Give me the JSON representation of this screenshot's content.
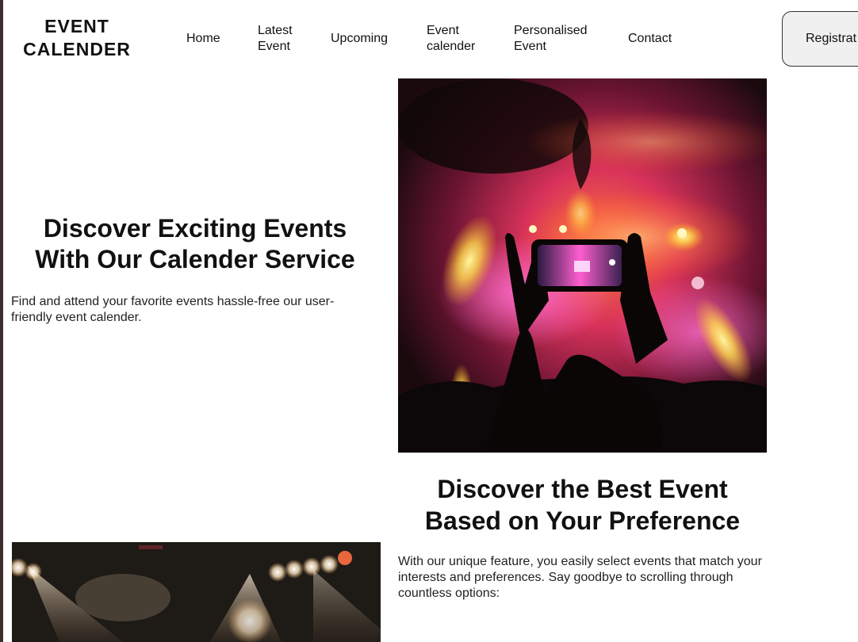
{
  "header": {
    "logo_line1": "EVENT",
    "logo_line2": "CALENDER",
    "nav": {
      "home": "Home",
      "latest_line1": "Latest",
      "latest_line2": "Event",
      "upcoming": "Upcoming",
      "calender_line1": "Event",
      "calender_line2": "calender",
      "personal_line1": "Personalised",
      "personal_line2": "Event",
      "contact": "Contact"
    },
    "register_label": "Registrat"
  },
  "hero": {
    "title_line1": "Discover Exciting Events",
    "title_line2": "With Our Calender Service",
    "subtitle": "Find and attend your favorite events hassle-free our user-friendly event calender."
  },
  "preference": {
    "title_line1": "Discover the Best Event",
    "title_line2": "Based on Your Preference",
    "text": "With our unique feature, you easily select events that match your interests and preferences. Say goodbye to scrolling through countless options:"
  },
  "colors": {
    "accent_border": "#333333",
    "button_bg": "#f0f0f0",
    "left_rail": "#3b2f2f"
  }
}
